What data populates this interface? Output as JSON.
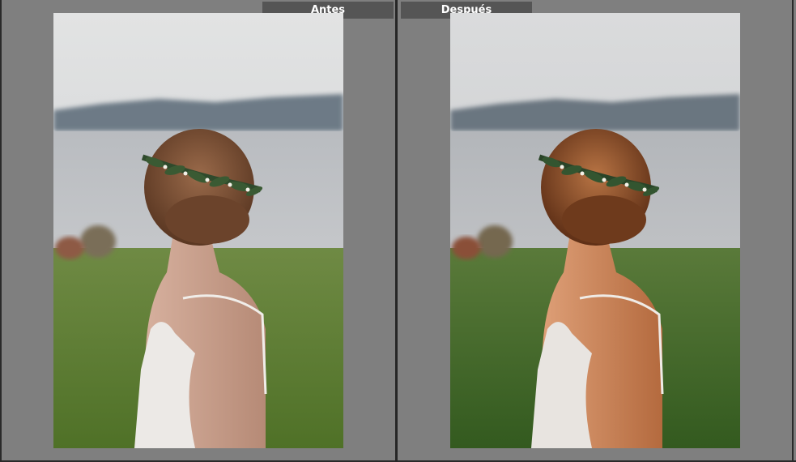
{
  "compare": {
    "before_label": "Antes",
    "after_label": "Después"
  },
  "colors": {
    "background": "#7f7f7f",
    "label_bar": "#555555",
    "label_text": "#ffffff",
    "divider": "#262626"
  }
}
